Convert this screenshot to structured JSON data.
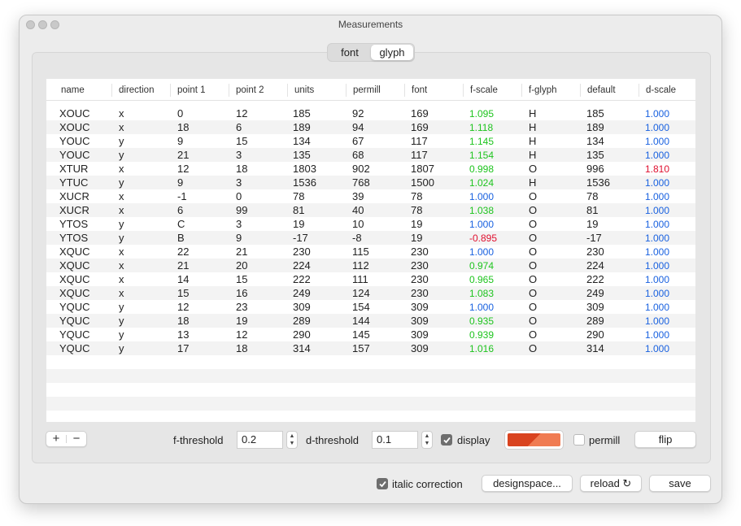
{
  "window": {
    "title": "Measurements"
  },
  "tabs": [
    {
      "label": "font",
      "selected": false
    },
    {
      "label": "glyph",
      "selected": true
    }
  ],
  "table": {
    "columns": [
      "name",
      "direction",
      "point 1",
      "point 2",
      "units",
      "permill",
      "font",
      "f-scale",
      "f-glyph",
      "default",
      "d-scale"
    ],
    "rows": [
      [
        "XOUC",
        "x",
        "0",
        "12",
        "185",
        "92",
        "169",
        "1.095",
        "H",
        "185",
        "1.000"
      ],
      [
        "XOUC",
        "x",
        "18",
        "6",
        "189",
        "94",
        "169",
        "1.118",
        "H",
        "189",
        "1.000"
      ],
      [
        "YOUC",
        "y",
        "9",
        "15",
        "134",
        "67",
        "117",
        "1.145",
        "H",
        "134",
        "1.000"
      ],
      [
        "YOUC",
        "y",
        "21",
        "3",
        "135",
        "68",
        "117",
        "1.154",
        "H",
        "135",
        "1.000"
      ],
      [
        "XTUR",
        "x",
        "12",
        "18",
        "1803",
        "902",
        "1807",
        "0.998",
        "O",
        "996",
        "1.810"
      ],
      [
        "YTUC",
        "y",
        "9",
        "3",
        "1536",
        "768",
        "1500",
        "1.024",
        "H",
        "1536",
        "1.000"
      ],
      [
        "XUCR",
        "x",
        "-1",
        "0",
        "78",
        "39",
        "78",
        "1.000",
        "O",
        "78",
        "1.000"
      ],
      [
        "XUCR",
        "x",
        "6",
        "99",
        "81",
        "40",
        "78",
        "1.038",
        "O",
        "81",
        "1.000"
      ],
      [
        "YTOS",
        "y",
        "C",
        "3",
        "19",
        "10",
        "19",
        "1.000",
        "O",
        "19",
        "1.000"
      ],
      [
        "YTOS",
        "y",
        "B",
        "9",
        "-17",
        "-8",
        "19",
        "-0.895",
        "O",
        "-17",
        "1.000"
      ],
      [
        "XQUC",
        "x",
        "22",
        "21",
        "230",
        "115",
        "230",
        "1.000",
        "O",
        "230",
        "1.000"
      ],
      [
        "XQUC",
        "x",
        "21",
        "20",
        "224",
        "112",
        "230",
        "0.974",
        "O",
        "224",
        "1.000"
      ],
      [
        "XQUC",
        "x",
        "14",
        "15",
        "222",
        "111",
        "230",
        "0.965",
        "O",
        "222",
        "1.000"
      ],
      [
        "XQUC",
        "x",
        "15",
        "16",
        "249",
        "124",
        "230",
        "1.083",
        "O",
        "249",
        "1.000"
      ],
      [
        "YQUC",
        "y",
        "12",
        "23",
        "309",
        "154",
        "309",
        "1.000",
        "O",
        "309",
        "1.000"
      ],
      [
        "YQUC",
        "y",
        "18",
        "19",
        "289",
        "144",
        "309",
        "0.935",
        "O",
        "289",
        "1.000"
      ],
      [
        "YQUC",
        "y",
        "13",
        "12",
        "290",
        "145",
        "309",
        "0.939",
        "O",
        "290",
        "1.000"
      ],
      [
        "YQUC",
        "y",
        "17",
        "18",
        "314",
        "157",
        "309",
        "1.016",
        "O",
        "314",
        "1.000"
      ]
    ],
    "fscale_status": [
      "green",
      "green",
      "green",
      "green",
      "green",
      "green",
      "blue",
      "green",
      "blue",
      "red",
      "blue",
      "green",
      "green",
      "green",
      "blue",
      "green",
      "green",
      "green"
    ],
    "dscale_status": [
      "blue",
      "blue",
      "blue",
      "blue",
      "red",
      "blue",
      "blue",
      "blue",
      "blue",
      "blue",
      "blue",
      "blue",
      "blue",
      "blue",
      "blue",
      "blue",
      "blue",
      "blue"
    ]
  },
  "status_colors": {
    "green": "#1ec41e",
    "blue": "#1a62e0",
    "red": "#e0102f"
  },
  "controls": {
    "add_label": "+",
    "remove_label": "−",
    "f_threshold_label": "f-threshold",
    "f_threshold_value": "0.2",
    "d_threshold_label": "d-threshold",
    "d_threshold_value": "0.1",
    "display_label": "display",
    "display_checked": true,
    "color_swatch": "#d9431f",
    "permill_label": "permill",
    "permill_checked": false,
    "flip_label": "flip"
  },
  "footer": {
    "italic_label": "italic correction",
    "italic_checked": true,
    "designspace_label": "designspace...",
    "reload_label": "reload ↻",
    "save_label": "save"
  }
}
